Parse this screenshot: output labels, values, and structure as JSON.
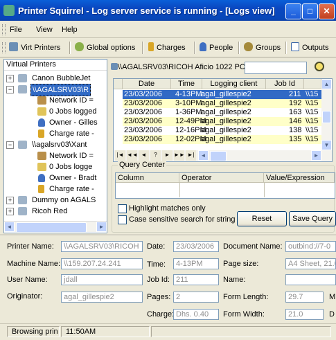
{
  "window": {
    "title": "Printer Squirrel - Log server service is running - [Logs view]",
    "minimize": "_",
    "maximize": "□",
    "close": "✕"
  },
  "menu": {
    "file": "File",
    "view": "View",
    "help": "Help"
  },
  "toolbar": {
    "virt_printers": "Virt Printers",
    "global_options": "Global options",
    "charges": "Charges",
    "people": "People",
    "groups": "Groups",
    "outputs": "Outputs"
  },
  "tree": {
    "header": "Virtual Printers",
    "items": [
      {
        "label": "Canon BubbleJet"
      },
      {
        "label": "\\\\AGALSRV03\\R"
      },
      {
        "label": "Network ID ="
      },
      {
        "label": "0 Jobs logged"
      },
      {
        "label": "Owner - Gilles"
      },
      {
        "label": "Charge rate -"
      },
      {
        "label": "\\\\agalsrv03\\Xant"
      },
      {
        "label": "Network ID ="
      },
      {
        "label": "0 Jobs logge"
      },
      {
        "label": "Owner - Bradt"
      },
      {
        "label": "Charge rate -"
      },
      {
        "label": "Dummy on AGALS"
      },
      {
        "label": "Ricoh Red"
      }
    ]
  },
  "printer_path": "\\\\AGALSRV03\\RICOH Aficio 1022 PCL 6 (Blue)",
  "log": {
    "columns": [
      "Date",
      "Time",
      "Logging client",
      "Job Id",
      ""
    ],
    "rows": [
      [
        "23/03/2006",
        "4-13PM",
        "agal_gillespie2",
        "211",
        "\\\\15"
      ],
      [
        "23/03/2006",
        "3-10PM",
        "agal_gillespie2",
        "192",
        "\\\\15"
      ],
      [
        "23/03/2006",
        "1-36PM",
        "agal_gillespie2",
        "163",
        "\\\\15"
      ],
      [
        "23/03/2006",
        "12-49PM",
        "agal_gillespie2",
        "146",
        "\\\\15"
      ],
      [
        "23/03/2006",
        "12-16PM",
        "agal_gillespie2",
        "138",
        "\\\\15"
      ],
      [
        "23/03/2006",
        "12-02PM",
        "agal_gillespie2",
        "135",
        "\\\\15"
      ]
    ],
    "nav": [
      "|◄",
      "◄◄",
      "◄",
      "?",
      "►",
      "►►",
      "►|"
    ]
  },
  "query_center": {
    "title": "Query Center",
    "columns": [
      "Column",
      "Operator",
      "Value/Expression"
    ],
    "highlight_label": "Highlight matches only",
    "case_label": "Case sensitive search for string",
    "reset_label": "Reset",
    "save_label": "Save Query"
  },
  "details": {
    "printer_name_label": "Printer Name:",
    "printer_name": "\\\\AGALSRV03\\RICOH",
    "date_label": "Date:",
    "date": "23/03/2006",
    "doc_name_label": "Document Name:",
    "doc_name": "outbind://7-0",
    "machine_label": "Machine Name:",
    "machine": "\\\\159.207.24.241",
    "time_label": "Time:",
    "time": "4-13PM",
    "page_size_label": "Page size:",
    "page_size": "A4 Sheet, 21.0",
    "user_label": "User Name:",
    "user": "jdall",
    "jobid_label": "Job Id:",
    "jobid": "211",
    "name_label": "Name:",
    "name": "",
    "originator_label": "Originator:",
    "originator": "agal_gillespie2",
    "pages_label": "Pages:",
    "pages": "2",
    "form_length_label": "Form Length:",
    "form_length": "29.7",
    "form_length_unit": "M",
    "charge_label": "Charge:",
    "charge": "Dhs. 0.40",
    "form_width_label": "Form Width:",
    "form_width": "21.0",
    "form_width_unit": "D"
  },
  "status": {
    "text": "Browsing prin",
    "time": "11:50AM"
  }
}
